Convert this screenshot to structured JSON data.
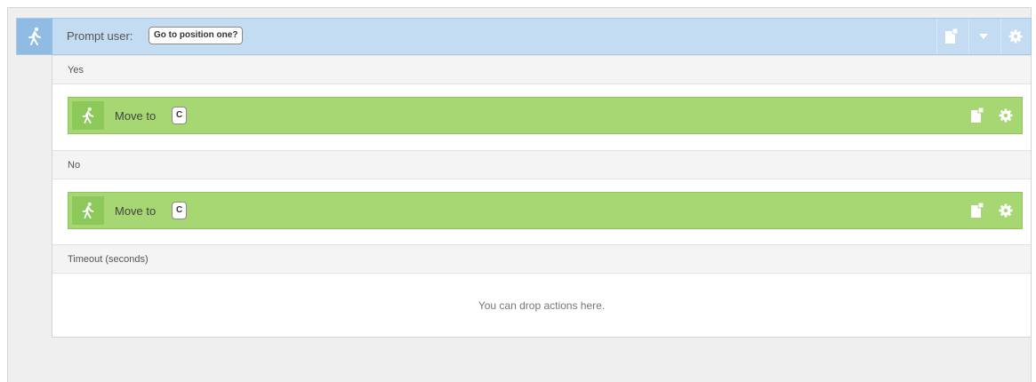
{
  "prompt": {
    "label": "Prompt user:",
    "value": "Go to position one?",
    "icon": "walking-person-icon",
    "buttons": [
      "paste-icon",
      "chevron-down-icon",
      "gear-icon"
    ]
  },
  "sections": {
    "yes_label": "Yes",
    "no_label": "No",
    "timeout_label": "Timeout (seconds)"
  },
  "yes_action": {
    "label": "Move to",
    "value": "C"
  },
  "no_action": {
    "label": "Move to",
    "value": "C"
  },
  "drop_hint": "You can drop actions here.",
  "colors": {
    "prompt_bg": "#c3dcf2",
    "prompt_icon_bg": "#90bce3",
    "action_bg": "#a6d773",
    "action_icon_bg": "#8cc85a"
  }
}
